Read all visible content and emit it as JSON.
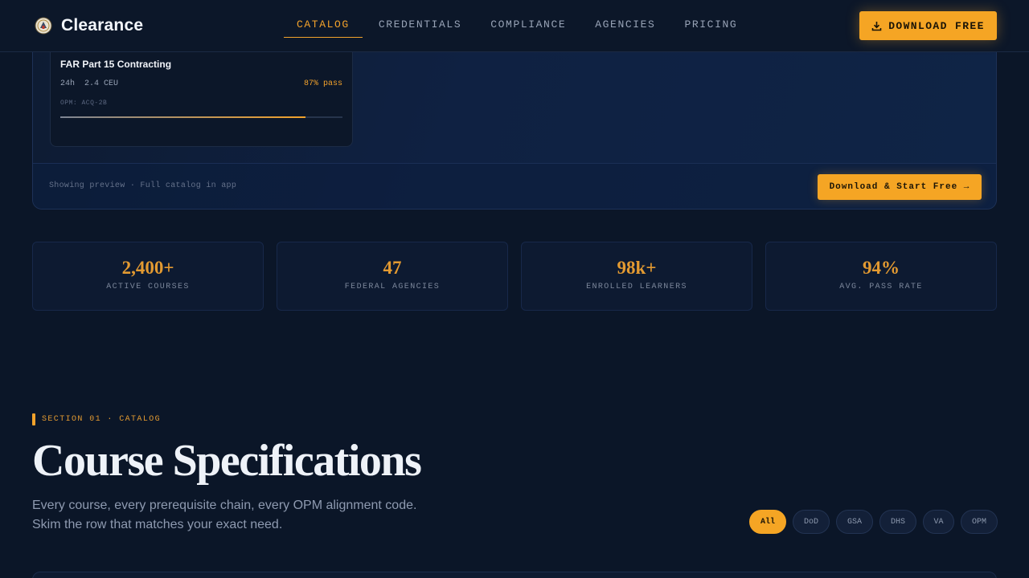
{
  "nav": {
    "brand": "Clearance",
    "links": [
      {
        "label": "CATALOG",
        "active": true
      },
      {
        "label": "CREDENTIALS",
        "active": false
      },
      {
        "label": "COMPLIANCE",
        "active": false
      },
      {
        "label": "AGENCIES",
        "active": false
      },
      {
        "label": "PRICING",
        "active": false
      }
    ],
    "cta": "DOWNLOAD FREE",
    "cta_icon": "download-icon"
  },
  "preview": {
    "course": {
      "title": "FAR Part 15 Contracting",
      "meta": "24h  2.4 CEU",
      "pass": "87% pass",
      "code": "OPM: ACQ-2B",
      "progress": 0.87
    },
    "note": "Showing preview · Full catalog in app",
    "cta": "Download & Start Free →"
  },
  "stats": [
    {
      "value": "2,400+",
      "label": "ACTIVE COURSES"
    },
    {
      "value": "47",
      "label": "FEDERAL AGENCIES"
    },
    {
      "value": "98k+",
      "label": "ENROLLED LEARNERS"
    },
    {
      "value": "94%",
      "label": "AVG. PASS RATE"
    }
  ],
  "section": {
    "tag": "SECTION 01 · CATALOG",
    "title": "Course Specifications",
    "subtitle_line1": "Every course, every prerequisite chain, every OPM alignment code.",
    "subtitle_line2": "Skim the row that matches your exact need."
  },
  "filters": [
    {
      "label": "All",
      "active": true
    },
    {
      "label": "DoD",
      "active": false
    },
    {
      "label": "GSA",
      "active": false
    },
    {
      "label": "DHS",
      "active": false
    },
    {
      "label": "VA",
      "active": false
    },
    {
      "label": "OPM",
      "active": false
    }
  ],
  "colors": {
    "accent": "#f5a524",
    "background": "#0b1628",
    "panel": "#0f2142"
  }
}
